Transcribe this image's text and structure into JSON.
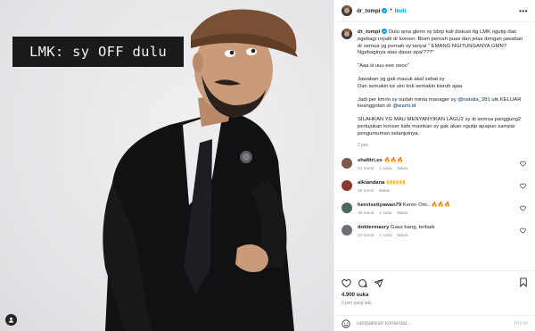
{
  "media": {
    "caption_overlay": "LMK: sy OFF dulu",
    "tag_icon": "user-tag-icon"
  },
  "header": {
    "username": "dr_tompi",
    "separator": "•",
    "follow_label": "Ikuti",
    "more_icon": "more-horizontal-icon"
  },
  "post": {
    "username": "dr_tompi",
    "paragraphs": [
      "Dulu ama glenn sy bbrp kali diskusi ttg LMK ngutip dan ngebagi royalti dr konser. Blum pernah puas dan jelas dengan jawaban dr semua yg pernah sy tanyai \" EMANG NGITUNGANYA GMN? Ngebaginya atas dasar apa!???\"",
      "\"Aaa iii uuu eee oooo\"",
      "Jawaban yg gak masuk akal sehat sy\nDan semakin ke sini kok semakin kisruh ajaa",
      "SILAHKAN YG MAU MENYANYIKAN LAGU2 sy di semua panggung2 pertujukan konser kafe mainkan sy gak akan ngutip apapun sampai pengumuman selanjutnya."
    ],
    "manager_line_prefix": "Jadi per kmrin sy sudah minta manager sy ",
    "manager_mention": "@natalia_281",
    "manager_line_mid": " utk KELUAR keanggotan dr ",
    "wami_mention": "@wami.id",
    "time": "2 jam"
  },
  "comments": [
    {
      "username": "shafitri.es",
      "text": "🔥🔥🔥",
      "time": "44 menit",
      "likes": "1 suka",
      "reply": "Balas",
      "avatar_color": "#7a5a4a"
    },
    {
      "username": "alkiandana",
      "text": "🙌🙌🙌",
      "time": "36 menit",
      "likes": "",
      "reply": "Balas",
      "avatar_color": "#8b3a2f"
    },
    {
      "username": "henrisetiyawan79",
      "text": "Keren Om...🔥🔥🔥",
      "time": "30 menit",
      "likes": "1 suka",
      "reply": "Balas",
      "avatar_color": "#4a6a5a"
    },
    {
      "username": "doktermasry",
      "text": "Gass bang, terbaik",
      "time": "22 menit",
      "likes": "1 suka",
      "reply": "Balas",
      "avatar_color": "#6f6f78"
    }
  ],
  "actions": {
    "likes": "4.900 suka",
    "time": "2 jam yang lalu"
  },
  "compose": {
    "placeholder": "Tambahkan komentar...",
    "send_label": "Kirim"
  },
  "colors": {
    "accent": "#0095f6",
    "mention": "#00376b",
    "muted": "#8e8e8e",
    "like_red": "#ff3040"
  }
}
